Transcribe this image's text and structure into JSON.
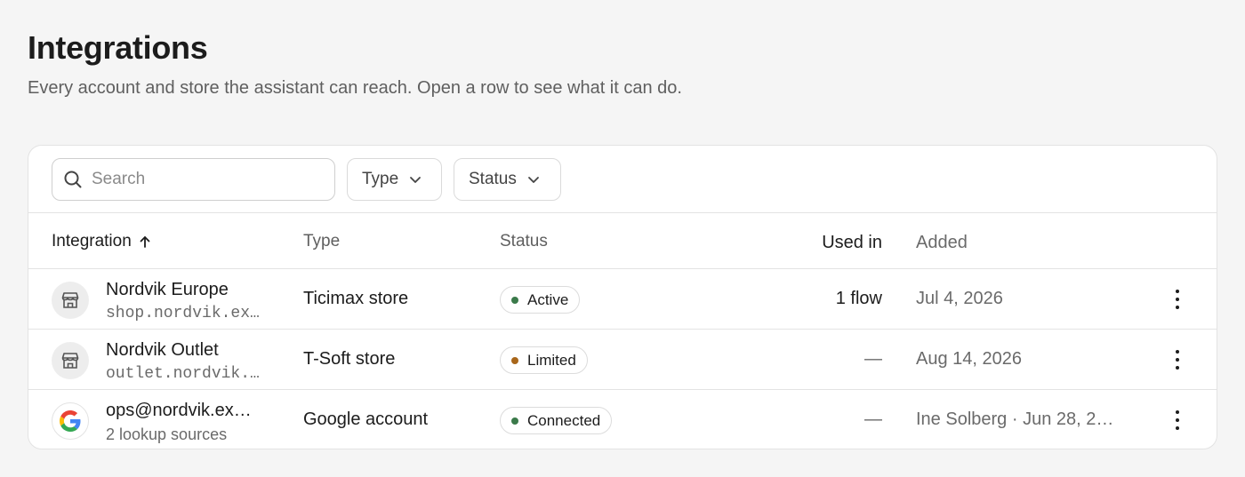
{
  "header": {
    "title": "Integrations",
    "subtitle": "Every account and store the assistant can reach. Open a row to see what it can do."
  },
  "toolbar": {
    "search_placeholder": "Search",
    "filter_type_label": "Type",
    "filter_status_label": "Status"
  },
  "table": {
    "columns": {
      "integration": "Integration",
      "type": "Type",
      "status": "Status",
      "used_in": "Used in",
      "added": "Added"
    },
    "sort": {
      "column": "integration",
      "direction": "ascending",
      "icon": "arrow-up-icon"
    },
    "rows": [
      {
        "name": "Nordvik Europe",
        "detail": "shop.nordvik.ex…",
        "icon": "store-icon",
        "type": "Ticimax store",
        "status": "Active",
        "status_color": "#3b7a4a",
        "used_in": "1 flow",
        "added": "Jul 4, 2026"
      },
      {
        "name": "Nordvik Outlet",
        "detail": "outlet.nordvik.…",
        "icon": "store-icon",
        "type": "T-Soft store",
        "status": "Limited",
        "status_color": "#a8661a",
        "used_in": "—",
        "added": "Aug 14, 2026"
      },
      {
        "name": "ops@nordvik.ex…",
        "detail": "2 lookup sources",
        "icon": "google-icon",
        "type": "Google account",
        "status": "Connected",
        "status_color": "#3b7a4a",
        "used_in": "—",
        "added": "Ine Solberg · Jun 28, 2…"
      }
    ]
  },
  "colors": {
    "background": "#f5f5f5",
    "card": "#ffffff",
    "border": "#e3e3e3",
    "text": "#1c1c1c",
    "muted": "#6a6a6a"
  }
}
